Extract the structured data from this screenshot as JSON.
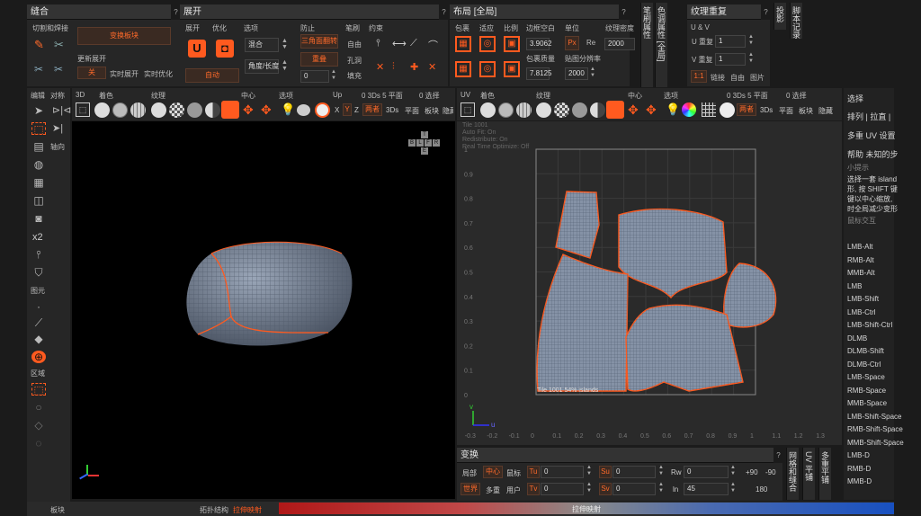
{
  "panels": {
    "stitch": "缝合",
    "unwrap": "展开",
    "layout": "布局 [全局]",
    "texture_repeat": "纹理重复",
    "transform": "变换",
    "select": "选择"
  },
  "stitch": {
    "cut_weld": "切割和焊接",
    "convert_seams": "变换板块",
    "update_unwrap": "更新展开",
    "off": "关",
    "realtime_unwrap": "实时展开",
    "realtime_optimize": "实时优化"
  },
  "unwrap": {
    "unwrap": "展开",
    "optimize": "优化",
    "options": "选项",
    "prevent": "防止",
    "brush": "笔刷",
    "constraint": "约束",
    "blend": "混合",
    "triangle_flip": "三角面翻转",
    "auto": "自动",
    "angle_length": "角度/长度",
    "overlap": "重叠",
    "free": "自由",
    "hole": "孔洞",
    "fill": "填充",
    "num_zero": "0"
  },
  "layout": {
    "pack": "包裹",
    "fit": "适应",
    "ratio": "比例",
    "margin": "边框空白",
    "unit": "单位",
    "texture_density": "纹理密度",
    "margin_val": "3.9062",
    "pack_quality": "包裹质量",
    "pack_val": "7.8125",
    "map_res": "贴图分辨率",
    "res_val": "2000",
    "density_val": "2000",
    "px": "Px",
    "re": "Re"
  },
  "texture_repeat": {
    "uv": "U & V",
    "u_repeat": "U 重复",
    "u_val": "1",
    "v_repeat": "V 重复",
    "v_val": "1",
    "ratio": "1:1",
    "link": "链接",
    "free": "自由",
    "image": "图片"
  },
  "vtabs": {
    "brush_attr": "笔刷属性",
    "color_attr": "色调属性 [全局]",
    "projection": "投影",
    "script_record": "脚本记录",
    "mesh_weld": "网格和缝合",
    "uv_flat": "UV 平铺",
    "multi_repeat": "多重平铺"
  },
  "left_tools": {
    "edit": "编辑",
    "symmetry": "对称",
    "axis": "轴向",
    "primitive": "图元",
    "region": "区域",
    "x2": "x2"
  },
  "view3d": {
    "label": "3D",
    "color": "着色",
    "texture": "纹理",
    "center": "中心",
    "options": "选项",
    "up": "Up",
    "stats": "0 3Ds 5 平面",
    "sel": "0 选择",
    "x": "X",
    "y": "Y",
    "z": "Z",
    "both": "两者",
    "threeds": "3Ds",
    "plane": "平面",
    "chunk": "板块",
    "hide": "隐藏",
    "nav_t": "T",
    "nav_b": "B",
    "nav_l": "L",
    "nav_f": "F",
    "nav_r": "R",
    "nav_e": "E"
  },
  "viewuv": {
    "label": "UV",
    "color": "着色",
    "texture": "纹理",
    "center": "中心",
    "options": "选项",
    "stats": "0 3Ds 5 平面",
    "sel": "0 选择",
    "both": "两者",
    "threeds": "3Ds",
    "plane": "平面",
    "chunk": "板块",
    "hide": "隐藏",
    "info1": "Tile 1001",
    "info2": "Auto Fit: On",
    "info3": "Redistribute: On",
    "info4": "Real Time Optimize: Off",
    "tile_info": "Tile 1001 54% islands",
    "axis_v": "v",
    "axis_u": "u"
  },
  "uv_yticks": [
    "1",
    "0.9",
    "0.8",
    "0.7",
    "0.6",
    "0.5",
    "0.4",
    "0.3",
    "0.2",
    "0.1",
    "0"
  ],
  "uv_xticks": [
    "-0.3",
    "-0.2",
    "-0.1",
    "0",
    "0.1",
    "0.2",
    "0.3",
    "0.4",
    "0.5",
    "0.6",
    "0.7",
    "0.8",
    "0.9",
    "1",
    "1.1",
    "1.2",
    "1.3"
  ],
  "transform": {
    "local": "局部",
    "center": "中心",
    "cursor": "鼠标",
    "tu": "Tu",
    "tu_val": "0",
    "su": "Su",
    "su_val": "0",
    "rw": "Rw",
    "rw_val": "0",
    "p90": "+90",
    "m90": "-90",
    "world": "世界",
    "multi": "多重",
    "user": "用户",
    "tv": "Tv",
    "tv_val": "0",
    "sv": "Sv",
    "sv_val": "0",
    "ln": "ln",
    "ln_val": "45",
    "deg180": "180"
  },
  "right_panel": {
    "arrange": "排列 | 拉直 |",
    "multi_uv": "多重 UV 设置",
    "help": "帮助 未知的步",
    "tips_title": "小提示",
    "tip1": "选择一套 island",
    "tip2": "形, 按 SHIFT 键",
    "tip3": "键以中心缩放, ",
    "tip4": "时全局减少变形",
    "mouse_interact": "鼠标交互",
    "items": [
      "LMB-Alt",
      "RMB-Alt",
      "MMB-Alt",
      "LMB",
      "LMB-Shift",
      "LMB-Ctrl",
      "LMB-Shift-Ctrl",
      "DLMB",
      "DLMB-Shift",
      "DLMB-Ctrl",
      "LMB-Space",
      "RMB-Space",
      "MMB-Space",
      "LMB-Shift-Space",
      "RMB-Shift-Space",
      "MMB-Shift-Space",
      "LMB-D",
      "RMB-D",
      "MMB-D"
    ]
  },
  "statusbar": {
    "chunk": "板块",
    "topo": "拓扑结构",
    "stretch_map": "拉伸映射",
    "stretch_map2": "拉伸映射"
  },
  "colors": {
    "accent": "#ff5a1f",
    "mesh": "#6b7a8f",
    "bg": "#1b1b1b"
  }
}
